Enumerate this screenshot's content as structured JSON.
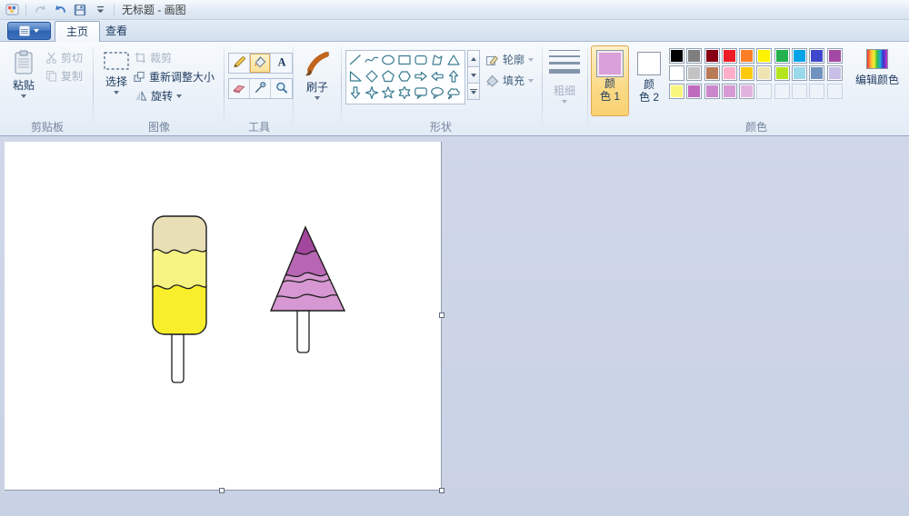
{
  "window": {
    "title": "无标题 - 画图"
  },
  "tabs": {
    "home": "主页",
    "view": "查看"
  },
  "ribbon": {
    "clipboard": {
      "group_label": "剪贴板",
      "paste_label": "粘贴",
      "cut_label": "剪切",
      "copy_label": "复制"
    },
    "image": {
      "group_label": "图像",
      "select_label": "选择",
      "crop_label": "裁剪",
      "resize_label": "重新调整大小",
      "rotate_label": "旋转"
    },
    "tools": {
      "group_label": "工具",
      "items": [
        "pencil",
        "fill",
        "text",
        "eraser",
        "eyedropper",
        "magnifier"
      ],
      "selected": "fill"
    },
    "brushes": {
      "button_label": "刷子"
    },
    "shapes": {
      "group_label": "形状",
      "outline_label": "轮廓",
      "fill_label": "填充",
      "items": [
        "line",
        "curve",
        "ellipse",
        "rectangle",
        "rounded-rectangle",
        "polygon",
        "triangle",
        "right-triangle",
        "diamond",
        "pentagon",
        "hexagon",
        "arrow-right",
        "arrow-left",
        "arrow-up",
        "arrow-down",
        "star-4",
        "star-5",
        "star-6",
        "callout-rounded",
        "callout-oval",
        "callout-cloud"
      ]
    },
    "stroke_size": {
      "button_label": "粗细"
    },
    "colors": {
      "group_label": "颜色",
      "color1_line1": "颜",
      "color1_line2": "色 1",
      "color1_value": "#d9a0da",
      "color2_line1": "颜",
      "color2_line2": "色 2",
      "color2_value": "#ffffff",
      "edit_colors_label": "编辑颜色",
      "palette": [
        [
          "#000000",
          "#7f7f7f",
          "#880015",
          "#ed1c24",
          "#ff7f27",
          "#fff200",
          "#22b14c",
          "#00a2e8",
          "#3f48cc",
          "#a349a4"
        ],
        [
          "#ffffff",
          "#c3c3c3",
          "#b97a57",
          "#ffaec9",
          "#ffc90e",
          "#efe4b0",
          "#b5e61d",
          "#99d9ea",
          "#7092be",
          "#c8bfe7"
        ],
        [
          "#f9f67e",
          "#bf6abf",
          "#cc86cc",
          "#d79ad4",
          "#e3b3e0",
          null,
          null,
          null,
          null,
          null
        ]
      ]
    }
  },
  "canvas_drawing": {
    "popsicle": {
      "band_top": "#e9dfb6",
      "band_middle": "#f7f382",
      "band_bottom": "#f8ee2b",
      "stick": "#ffffff",
      "outline": "#1c1c1c"
    },
    "tree": {
      "band_top": "#a2479e",
      "band_middle": "#b766b3",
      "band_bottom": "#d697d2",
      "stick": "#ffffff",
      "outline": "#1c1c1c"
    }
  }
}
